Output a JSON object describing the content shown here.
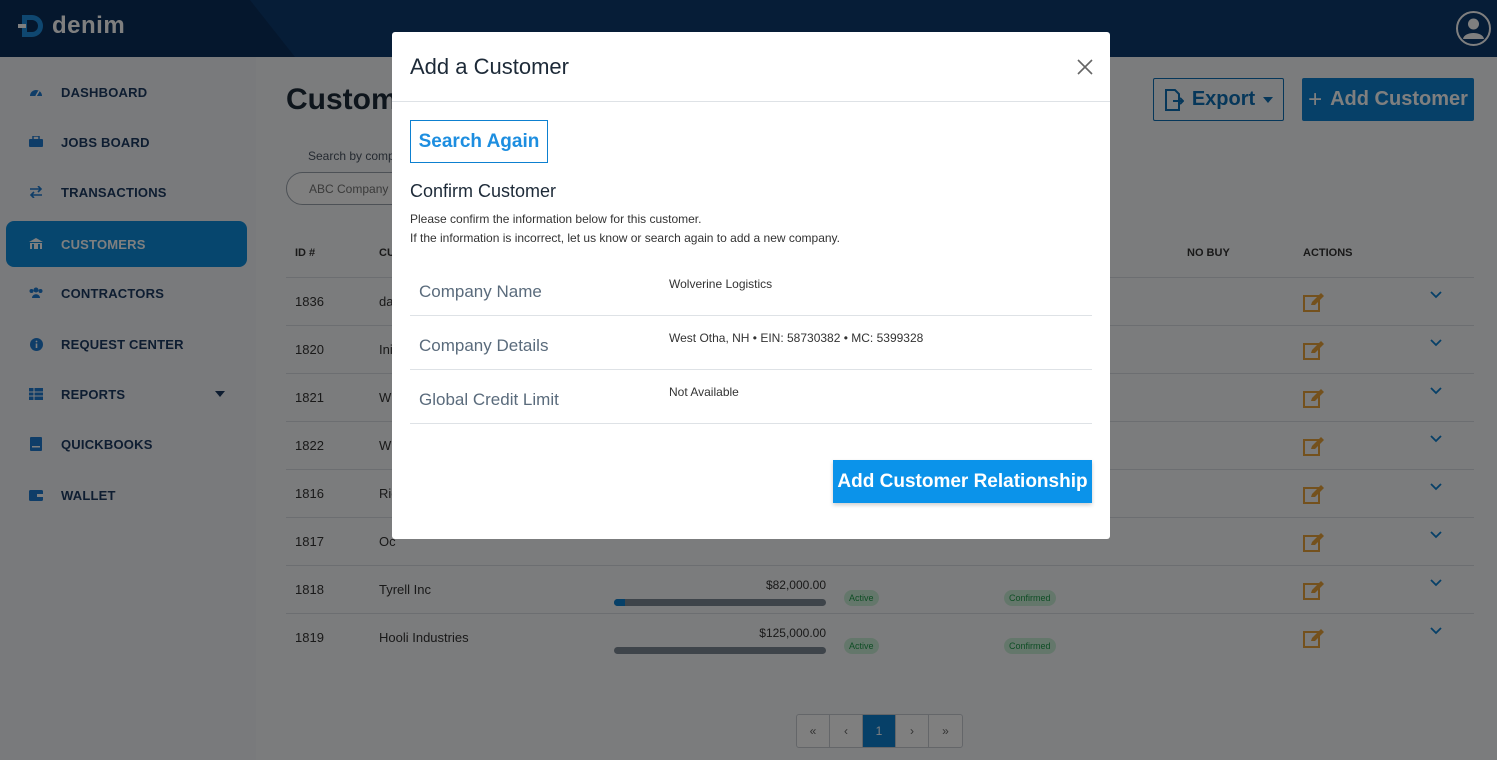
{
  "app": {
    "brand": "denim"
  },
  "sidebar": {
    "items": [
      {
        "label": "DASHBOARD",
        "icon": "dashboard-icon"
      },
      {
        "label": "JOBS BOARD",
        "icon": "jobs-board-icon"
      },
      {
        "label": "TRANSACTIONS",
        "icon": "transactions-icon"
      },
      {
        "label": "CUSTOMERS",
        "icon": "customers-icon",
        "active": true
      },
      {
        "label": "CONTRACTORS",
        "icon": "contractors-icon"
      },
      {
        "label": "REQUEST CENTER",
        "icon": "info-icon"
      },
      {
        "label": "REPORTS",
        "icon": "reports-icon"
      },
      {
        "label": "QUICKBOOKS",
        "icon": "quickbooks-icon"
      },
      {
        "label": "WALLET",
        "icon": "wallet-icon"
      }
    ]
  },
  "main": {
    "title": "Customers",
    "export_label": "Export",
    "add_label": "Add Customer",
    "search_label": "Search by company",
    "search_placeholder": "ABC Company",
    "columns": {
      "id": "ID #",
      "customer": "CU",
      "no_buy": "NO BUY",
      "actions": "ACTIONS"
    },
    "rows": [
      {
        "id": "1836",
        "name": "da",
        "amount": "",
        "progress": 0,
        "status": "",
        "conf": ""
      },
      {
        "id": "1820",
        "name": "Ini",
        "amount": "",
        "progress": 0,
        "status": "",
        "conf": ""
      },
      {
        "id": "1821",
        "name": "W",
        "amount": "",
        "progress": 0,
        "status": "",
        "conf": ""
      },
      {
        "id": "1822",
        "name": "W",
        "amount": "",
        "progress": 0,
        "status": "",
        "conf": ""
      },
      {
        "id": "1816",
        "name": "Ric",
        "amount": "",
        "progress": 0,
        "status": "",
        "conf": ""
      },
      {
        "id": "1817",
        "name": "Oc",
        "amount": "",
        "progress": 0,
        "status": "",
        "conf": ""
      },
      {
        "id": "1818",
        "name": "Tyrell Inc",
        "amount": "$82,000.00",
        "progress": 0.05,
        "status": "Active",
        "conf": "Confirmed"
      },
      {
        "id": "1819",
        "name": "Hooli Industries",
        "amount": "$125,000.00",
        "progress": 0,
        "status": "Active",
        "conf": "Confirmed"
      }
    ],
    "pager": {
      "first": "«",
      "prev": "‹",
      "current": "1",
      "next": "›",
      "last": "»"
    }
  },
  "modal": {
    "title": "Add a Customer",
    "search_again": "Search Again",
    "confirm_title": "Confirm Customer",
    "desc1": "Please confirm the information below for this customer.",
    "desc2": "If the information is incorrect, let us know or search again to add a new company.",
    "fields": [
      {
        "label": "Company Name",
        "value": "Wolverine Logistics"
      },
      {
        "label": "Company Details",
        "value": "West Otha, NH • EIN: 58730382 • MC: 5399328"
      },
      {
        "label": "Global Credit Limit",
        "value": "Not Available"
      }
    ],
    "submit": "Add Customer Relationship"
  },
  "colors": {
    "primary": "#0d80d0",
    "navy": "#0d3a6e",
    "accent_orange": "#e8a33a",
    "success": "#1e9b4b"
  }
}
